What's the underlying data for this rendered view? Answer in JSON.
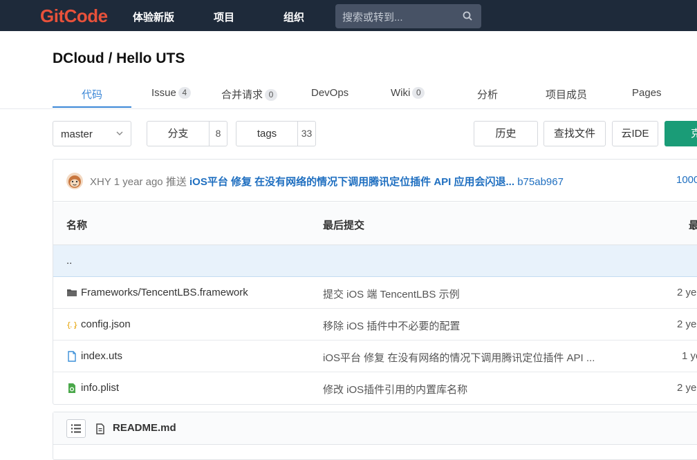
{
  "topbar": {
    "logo": "GitCode",
    "nav": [
      "体验新版",
      "项目",
      "组织"
    ],
    "search_placeholder": "搜索或转到..."
  },
  "repo": {
    "title": "DCloud / Hello UTS"
  },
  "tabs": [
    {
      "label": "代码",
      "count": ""
    },
    {
      "label": "Issue",
      "count": "4"
    },
    {
      "label": "合并请求",
      "count": "0"
    },
    {
      "label": "DevOps",
      "count": ""
    },
    {
      "label": "Wiki",
      "count": "0"
    },
    {
      "label": "分析",
      "count": ""
    },
    {
      "label": "项目成员",
      "count": ""
    },
    {
      "label": "Pages",
      "count": ""
    }
  ],
  "toolbar": {
    "branch": "master",
    "branches_label": "分支",
    "branches_count": "8",
    "tags_label": "tags",
    "tags_count": "33",
    "history": "历史",
    "find_file": "查找文件",
    "cloud_ide": "云IDE",
    "clone": "克"
  },
  "commit": {
    "author": "XHY",
    "time": "1 year ago",
    "action": "推送",
    "message": "iOS平台 修复 在没有网络的情况下调用腾讯定位插件 API 应用会闪退...",
    "sha": "b75ab967",
    "count": "1000"
  },
  "table": {
    "headers": [
      "名称",
      "最后提交",
      "最"
    ],
    "parent": "..",
    "rows": [
      {
        "icon": "folder-icon",
        "name": "Frameworks/TencentLBS.framework",
        "message": "提交 iOS 端 TencentLBS 示例",
        "time": "2 ye"
      },
      {
        "icon": "json-file-icon",
        "name": "config.json",
        "message": "移除 iOS 插件中不必要的配置",
        "time": "2 ye"
      },
      {
        "icon": "file-icon",
        "name": "index.uts",
        "message": "iOS平台 修复 在没有网络的情况下调用腾讯定位插件 API ...",
        "time": "1 ye"
      },
      {
        "icon": "plist-file-icon",
        "name": "info.plist",
        "message": "修改 iOS插件引用的内置库名称",
        "time": "2 ye"
      }
    ]
  },
  "readme": {
    "title": "README.md"
  }
}
